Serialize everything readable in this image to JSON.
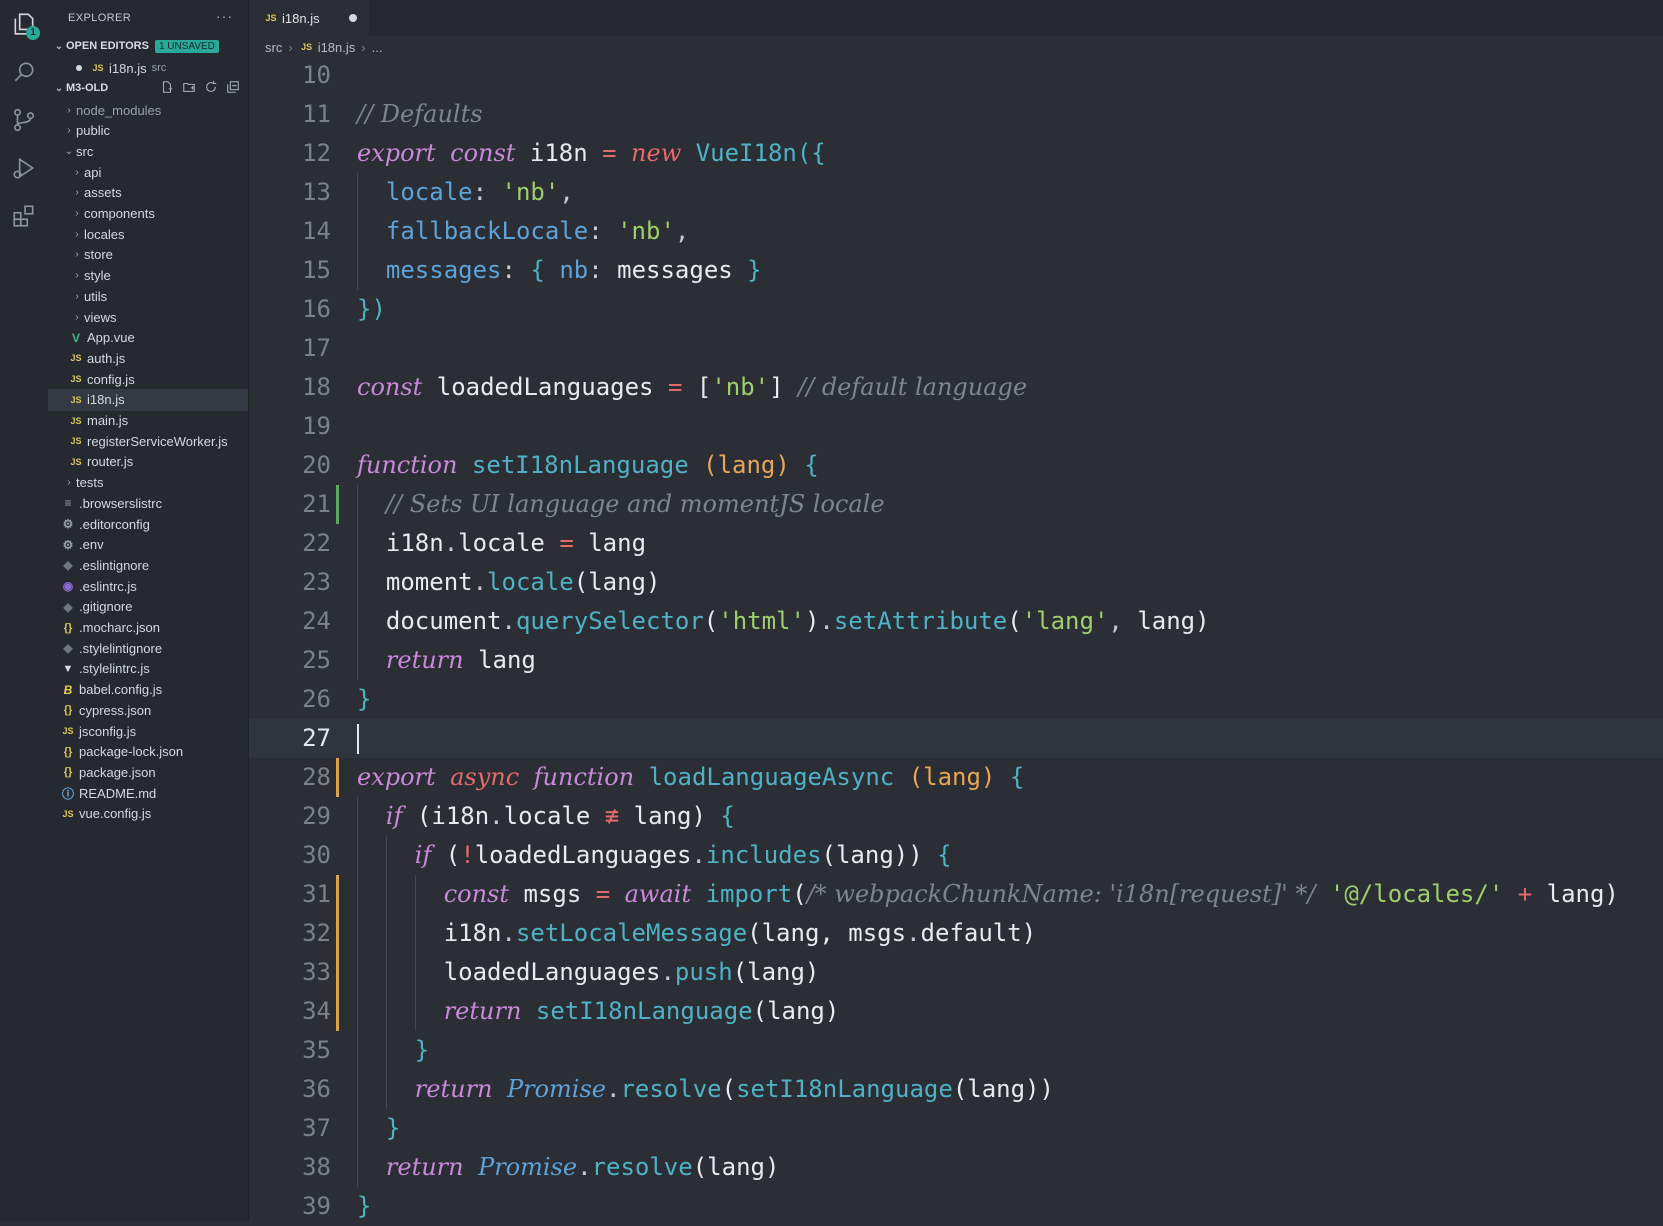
{
  "activity_bar": {
    "items": [
      {
        "icon": "files-icon",
        "badge": "1"
      },
      {
        "icon": "search-icon"
      },
      {
        "icon": "source-control-icon"
      },
      {
        "icon": "run-debug-icon"
      },
      {
        "icon": "extensions-icon"
      }
    ]
  },
  "sidebar": {
    "title": "EXPLORER",
    "more": "···",
    "open_editors": {
      "label": "OPEN EDITORS",
      "badge": "1 UNSAVED",
      "items": [
        {
          "name": "i18n.js",
          "dir": "src",
          "icon": "JS"
        }
      ]
    },
    "project": {
      "label": "M3-OLD",
      "tree": [
        {
          "name": "node_modules",
          "type": "folder",
          "depth": 1,
          "dim": true
        },
        {
          "name": "public",
          "type": "folder",
          "depth": 1
        },
        {
          "name": "src",
          "type": "folder-open",
          "depth": 1
        },
        {
          "name": "api",
          "type": "folder",
          "depth": 2
        },
        {
          "name": "assets",
          "type": "folder",
          "depth": 2
        },
        {
          "name": "components",
          "type": "folder",
          "depth": 2
        },
        {
          "name": "locales",
          "type": "folder",
          "depth": 2
        },
        {
          "name": "store",
          "type": "folder",
          "depth": 2
        },
        {
          "name": "style",
          "type": "folder",
          "depth": 2
        },
        {
          "name": "utils",
          "type": "folder",
          "depth": 2
        },
        {
          "name": "views",
          "type": "folder",
          "depth": 2
        },
        {
          "name": "App.vue",
          "type": "vue",
          "depth": 2
        },
        {
          "name": "auth.js",
          "type": "js",
          "depth": 2
        },
        {
          "name": "config.js",
          "type": "js",
          "depth": 2
        },
        {
          "name": "i18n.js",
          "type": "js",
          "depth": 2,
          "selected": true
        },
        {
          "name": "main.js",
          "type": "js",
          "depth": 2
        },
        {
          "name": "registerServiceWorker.js",
          "type": "js",
          "depth": 2
        },
        {
          "name": "router.js",
          "type": "js",
          "depth": 2
        },
        {
          "name": "tests",
          "type": "folder",
          "depth": 1
        },
        {
          "name": ".browserslistrc",
          "type": "lines",
          "depth": 1
        },
        {
          "name": ".editorconfig",
          "type": "gear",
          "depth": 1
        },
        {
          "name": ".env",
          "type": "gear",
          "depth": 1
        },
        {
          "name": ".eslintignore",
          "type": "grey",
          "depth": 1
        },
        {
          "name": ".eslintrc.js",
          "type": "eslint",
          "depth": 1
        },
        {
          "name": ".gitignore",
          "type": "grey",
          "depth": 1
        },
        {
          "name": ".mocharc.json",
          "type": "json",
          "depth": 1
        },
        {
          "name": ".stylelintignore",
          "type": "grey",
          "depth": 1
        },
        {
          "name": ".stylelintrc.js",
          "type": "style",
          "depth": 1
        },
        {
          "name": "babel.config.js",
          "type": "babel",
          "depth": 1
        },
        {
          "name": "cypress.json",
          "type": "json",
          "depth": 1
        },
        {
          "name": "jsconfig.js",
          "type": "js",
          "depth": 1
        },
        {
          "name": "package-lock.json",
          "type": "json",
          "depth": 1
        },
        {
          "name": "package.json",
          "type": "json",
          "depth": 1
        },
        {
          "name": "README.md",
          "type": "info",
          "depth": 1
        },
        {
          "name": "vue.config.js",
          "type": "js",
          "depth": 1
        }
      ]
    }
  },
  "editor": {
    "tab": {
      "label": "i18n.js",
      "icon": "JS",
      "unsaved": true
    },
    "breadcrumb": [
      "src",
      "i18n.js",
      "..."
    ],
    "current_line": 27,
    "lines": [
      {
        "n": 10,
        "tokens": []
      },
      {
        "n": 11,
        "tokens": [
          [
            "c-cmt",
            "// Defaults"
          ]
        ]
      },
      {
        "n": 12,
        "tokens": [
          [
            "c-kw",
            "export"
          ],
          [
            "c-plain",
            " "
          ],
          [
            "c-kw",
            "const"
          ],
          [
            "c-plain",
            " i18n "
          ],
          [
            "c-op",
            "="
          ],
          [
            "c-plain",
            " "
          ],
          [
            "c-kw2",
            "new"
          ],
          [
            "c-plain",
            " "
          ],
          [
            "c-fn",
            "VueI18n"
          ],
          [
            "c-brace",
            "({"
          ]
        ]
      },
      {
        "n": 13,
        "tokens": [
          [
            "c-plain",
            "  "
          ],
          [
            "c-prop",
            "locale"
          ],
          [
            "c-punc",
            ": "
          ],
          [
            "c-str",
            "'nb'"
          ],
          [
            "c-punc",
            ","
          ]
        ]
      },
      {
        "n": 14,
        "tokens": [
          [
            "c-plain",
            "  "
          ],
          [
            "c-prop",
            "fallbackLocale"
          ],
          [
            "c-punc",
            ": "
          ],
          [
            "c-str",
            "'nb'"
          ],
          [
            "c-punc",
            ","
          ]
        ]
      },
      {
        "n": 15,
        "tokens": [
          [
            "c-plain",
            "  "
          ],
          [
            "c-prop",
            "messages"
          ],
          [
            "c-punc",
            ": "
          ],
          [
            "c-brace",
            "{"
          ],
          [
            "c-plain",
            " "
          ],
          [
            "c-prop",
            "nb"
          ],
          [
            "c-punc",
            ":"
          ],
          [
            "c-plain",
            " messages "
          ],
          [
            "c-brace",
            "}"
          ]
        ]
      },
      {
        "n": 16,
        "tokens": [
          [
            "c-brace",
            "})"
          ]
        ]
      },
      {
        "n": 17,
        "tokens": []
      },
      {
        "n": 18,
        "tokens": [
          [
            "c-kw",
            "const"
          ],
          [
            "c-plain",
            " loadedLanguages "
          ],
          [
            "c-op",
            "="
          ],
          [
            "c-plain",
            " ["
          ],
          [
            "c-str",
            "'nb'"
          ],
          [
            "c-plain",
            "] "
          ],
          [
            "c-cmt",
            "// default language"
          ]
        ]
      },
      {
        "n": 19,
        "tokens": []
      },
      {
        "n": 20,
        "tokens": [
          [
            "c-kw",
            "function"
          ],
          [
            "c-plain",
            " "
          ],
          [
            "c-fn",
            "setI18nLanguage"
          ],
          [
            "c-plain",
            " "
          ],
          [
            "c-param",
            "(lang)"
          ],
          [
            "c-plain",
            " "
          ],
          [
            "c-brace",
            "{"
          ]
        ]
      },
      {
        "n": 21,
        "tokens": [
          [
            "c-plain",
            "  "
          ],
          [
            "c-cmt",
            "// Sets UI language and momentJS locale"
          ]
        ]
      },
      {
        "n": 22,
        "tokens": [
          [
            "c-plain",
            "  i18n"
          ],
          [
            "c-punc",
            "."
          ],
          [
            "c-plain",
            "locale "
          ],
          [
            "c-op",
            "="
          ],
          [
            "c-plain",
            " lang"
          ]
        ]
      },
      {
        "n": 23,
        "tokens": [
          [
            "c-plain",
            "  moment"
          ],
          [
            "c-punc",
            "."
          ],
          [
            "c-fn",
            "locale"
          ],
          [
            "c-plain",
            "(lang)"
          ]
        ]
      },
      {
        "n": 24,
        "tokens": [
          [
            "c-plain",
            "  document"
          ],
          [
            "c-punc",
            "."
          ],
          [
            "c-fn",
            "querySelector"
          ],
          [
            "c-plain",
            "("
          ],
          [
            "c-str",
            "'html'"
          ],
          [
            "c-plain",
            ")"
          ],
          [
            "c-punc",
            "."
          ],
          [
            "c-fn",
            "setAttribute"
          ],
          [
            "c-plain",
            "("
          ],
          [
            "c-str",
            "'lang'"
          ],
          [
            "c-punc",
            ", "
          ],
          [
            "c-plain",
            "lang)"
          ]
        ]
      },
      {
        "n": 25,
        "tokens": [
          [
            "c-plain",
            "  "
          ],
          [
            "c-kw",
            "return"
          ],
          [
            "c-plain",
            " lang"
          ]
        ]
      },
      {
        "n": 26,
        "tokens": [
          [
            "c-brace",
            "}"
          ]
        ]
      },
      {
        "n": 27,
        "tokens": []
      },
      {
        "n": 28,
        "tokens": [
          [
            "c-kw",
            "export"
          ],
          [
            "c-plain",
            " "
          ],
          [
            "c-kw2",
            "async"
          ],
          [
            "c-plain",
            " "
          ],
          [
            "c-kw",
            "function"
          ],
          [
            "c-plain",
            " "
          ],
          [
            "c-fn",
            "loadLanguageAsync"
          ],
          [
            "c-plain",
            " "
          ],
          [
            "c-param",
            "(lang)"
          ],
          [
            "c-plain",
            " "
          ],
          [
            "c-brace",
            "{"
          ]
        ]
      },
      {
        "n": 29,
        "tokens": [
          [
            "c-plain",
            "  "
          ],
          [
            "c-kw",
            "if"
          ],
          [
            "c-plain",
            " (i18n"
          ],
          [
            "c-punc",
            "."
          ],
          [
            "c-plain",
            "locale "
          ],
          [
            "c-op",
            "≢"
          ],
          [
            "c-plain",
            " lang) "
          ],
          [
            "c-brace",
            "{"
          ]
        ]
      },
      {
        "n": 30,
        "tokens": [
          [
            "c-plain",
            "    "
          ],
          [
            "c-kw",
            "if"
          ],
          [
            "c-plain",
            " ("
          ],
          [
            "c-op",
            "!"
          ],
          [
            "c-plain",
            "loadedLanguages"
          ],
          [
            "c-punc",
            "."
          ],
          [
            "c-fn",
            "includes"
          ],
          [
            "c-plain",
            "(lang)) "
          ],
          [
            "c-brace",
            "{"
          ]
        ]
      },
      {
        "n": 31,
        "tokens": [
          [
            "c-plain",
            "      "
          ],
          [
            "c-kw",
            "const"
          ],
          [
            "c-plain",
            " msgs "
          ],
          [
            "c-op",
            "="
          ],
          [
            "c-plain",
            " "
          ],
          [
            "c-kw",
            "await"
          ],
          [
            "c-plain",
            " "
          ],
          [
            "c-fn",
            "import"
          ],
          [
            "c-plain",
            "("
          ],
          [
            "c-cmt",
            "/* webpackChunkName: 'i18n[request]' */"
          ],
          [
            "c-plain",
            " "
          ],
          [
            "c-str",
            "'@/locales/'"
          ],
          [
            "c-plain",
            " "
          ],
          [
            "c-op",
            "+"
          ],
          [
            "c-plain",
            " lang)"
          ]
        ]
      },
      {
        "n": 32,
        "tokens": [
          [
            "c-plain",
            "      i18n"
          ],
          [
            "c-punc",
            "."
          ],
          [
            "c-fn",
            "setLocaleMessage"
          ],
          [
            "c-plain",
            "(lang, msgs"
          ],
          [
            "c-punc",
            "."
          ],
          [
            "c-plain",
            "default)"
          ]
        ]
      },
      {
        "n": 33,
        "tokens": [
          [
            "c-plain",
            "      loadedLanguages"
          ],
          [
            "c-punc",
            "."
          ],
          [
            "c-fn",
            "push"
          ],
          [
            "c-plain",
            "(lang)"
          ]
        ]
      },
      {
        "n": 34,
        "tokens": [
          [
            "c-plain",
            "      "
          ],
          [
            "c-kw",
            "return"
          ],
          [
            "c-plain",
            " "
          ],
          [
            "c-fn",
            "setI18nLanguage"
          ],
          [
            "c-plain",
            "(lang)"
          ]
        ]
      },
      {
        "n": 35,
        "tokens": [
          [
            "c-plain",
            "    "
          ],
          [
            "c-brace",
            "}"
          ]
        ]
      },
      {
        "n": 36,
        "tokens": [
          [
            "c-plain",
            "    "
          ],
          [
            "c-kw",
            "return"
          ],
          [
            "c-plain",
            " "
          ],
          [
            "c-cls",
            "Promise"
          ],
          [
            "c-punc",
            "."
          ],
          [
            "c-fn",
            "resolve"
          ],
          [
            "c-plain",
            "("
          ],
          [
            "c-fn",
            "setI18nLanguage"
          ],
          [
            "c-plain",
            "(lang))"
          ]
        ]
      },
      {
        "n": 37,
        "tokens": [
          [
            "c-plain",
            "  "
          ],
          [
            "c-brace",
            "}"
          ]
        ]
      },
      {
        "n": 38,
        "tokens": [
          [
            "c-plain",
            "  "
          ],
          [
            "c-kw",
            "return"
          ],
          [
            "c-plain",
            " "
          ],
          [
            "c-cls",
            "Promise"
          ],
          [
            "c-punc",
            "."
          ],
          [
            "c-fn",
            "resolve"
          ],
          [
            "c-plain",
            "(lang)"
          ]
        ]
      },
      {
        "n": 39,
        "tokens": [
          [
            "c-brace",
            "}"
          ]
        ]
      }
    ],
    "gutter_marks": [
      {
        "line": 21,
        "color": "green"
      },
      {
        "line": 28,
        "color": "yellow"
      },
      {
        "line": 31,
        "color": "yellow"
      },
      {
        "line": 32,
        "color": "yellow"
      },
      {
        "line": 33,
        "color": "yellow"
      },
      {
        "line": 34,
        "color": "yellow"
      }
    ]
  },
  "colors": {
    "accent": "#2aa89a",
    "background": "#2b2e35",
    "sidebar": "#262930"
  }
}
